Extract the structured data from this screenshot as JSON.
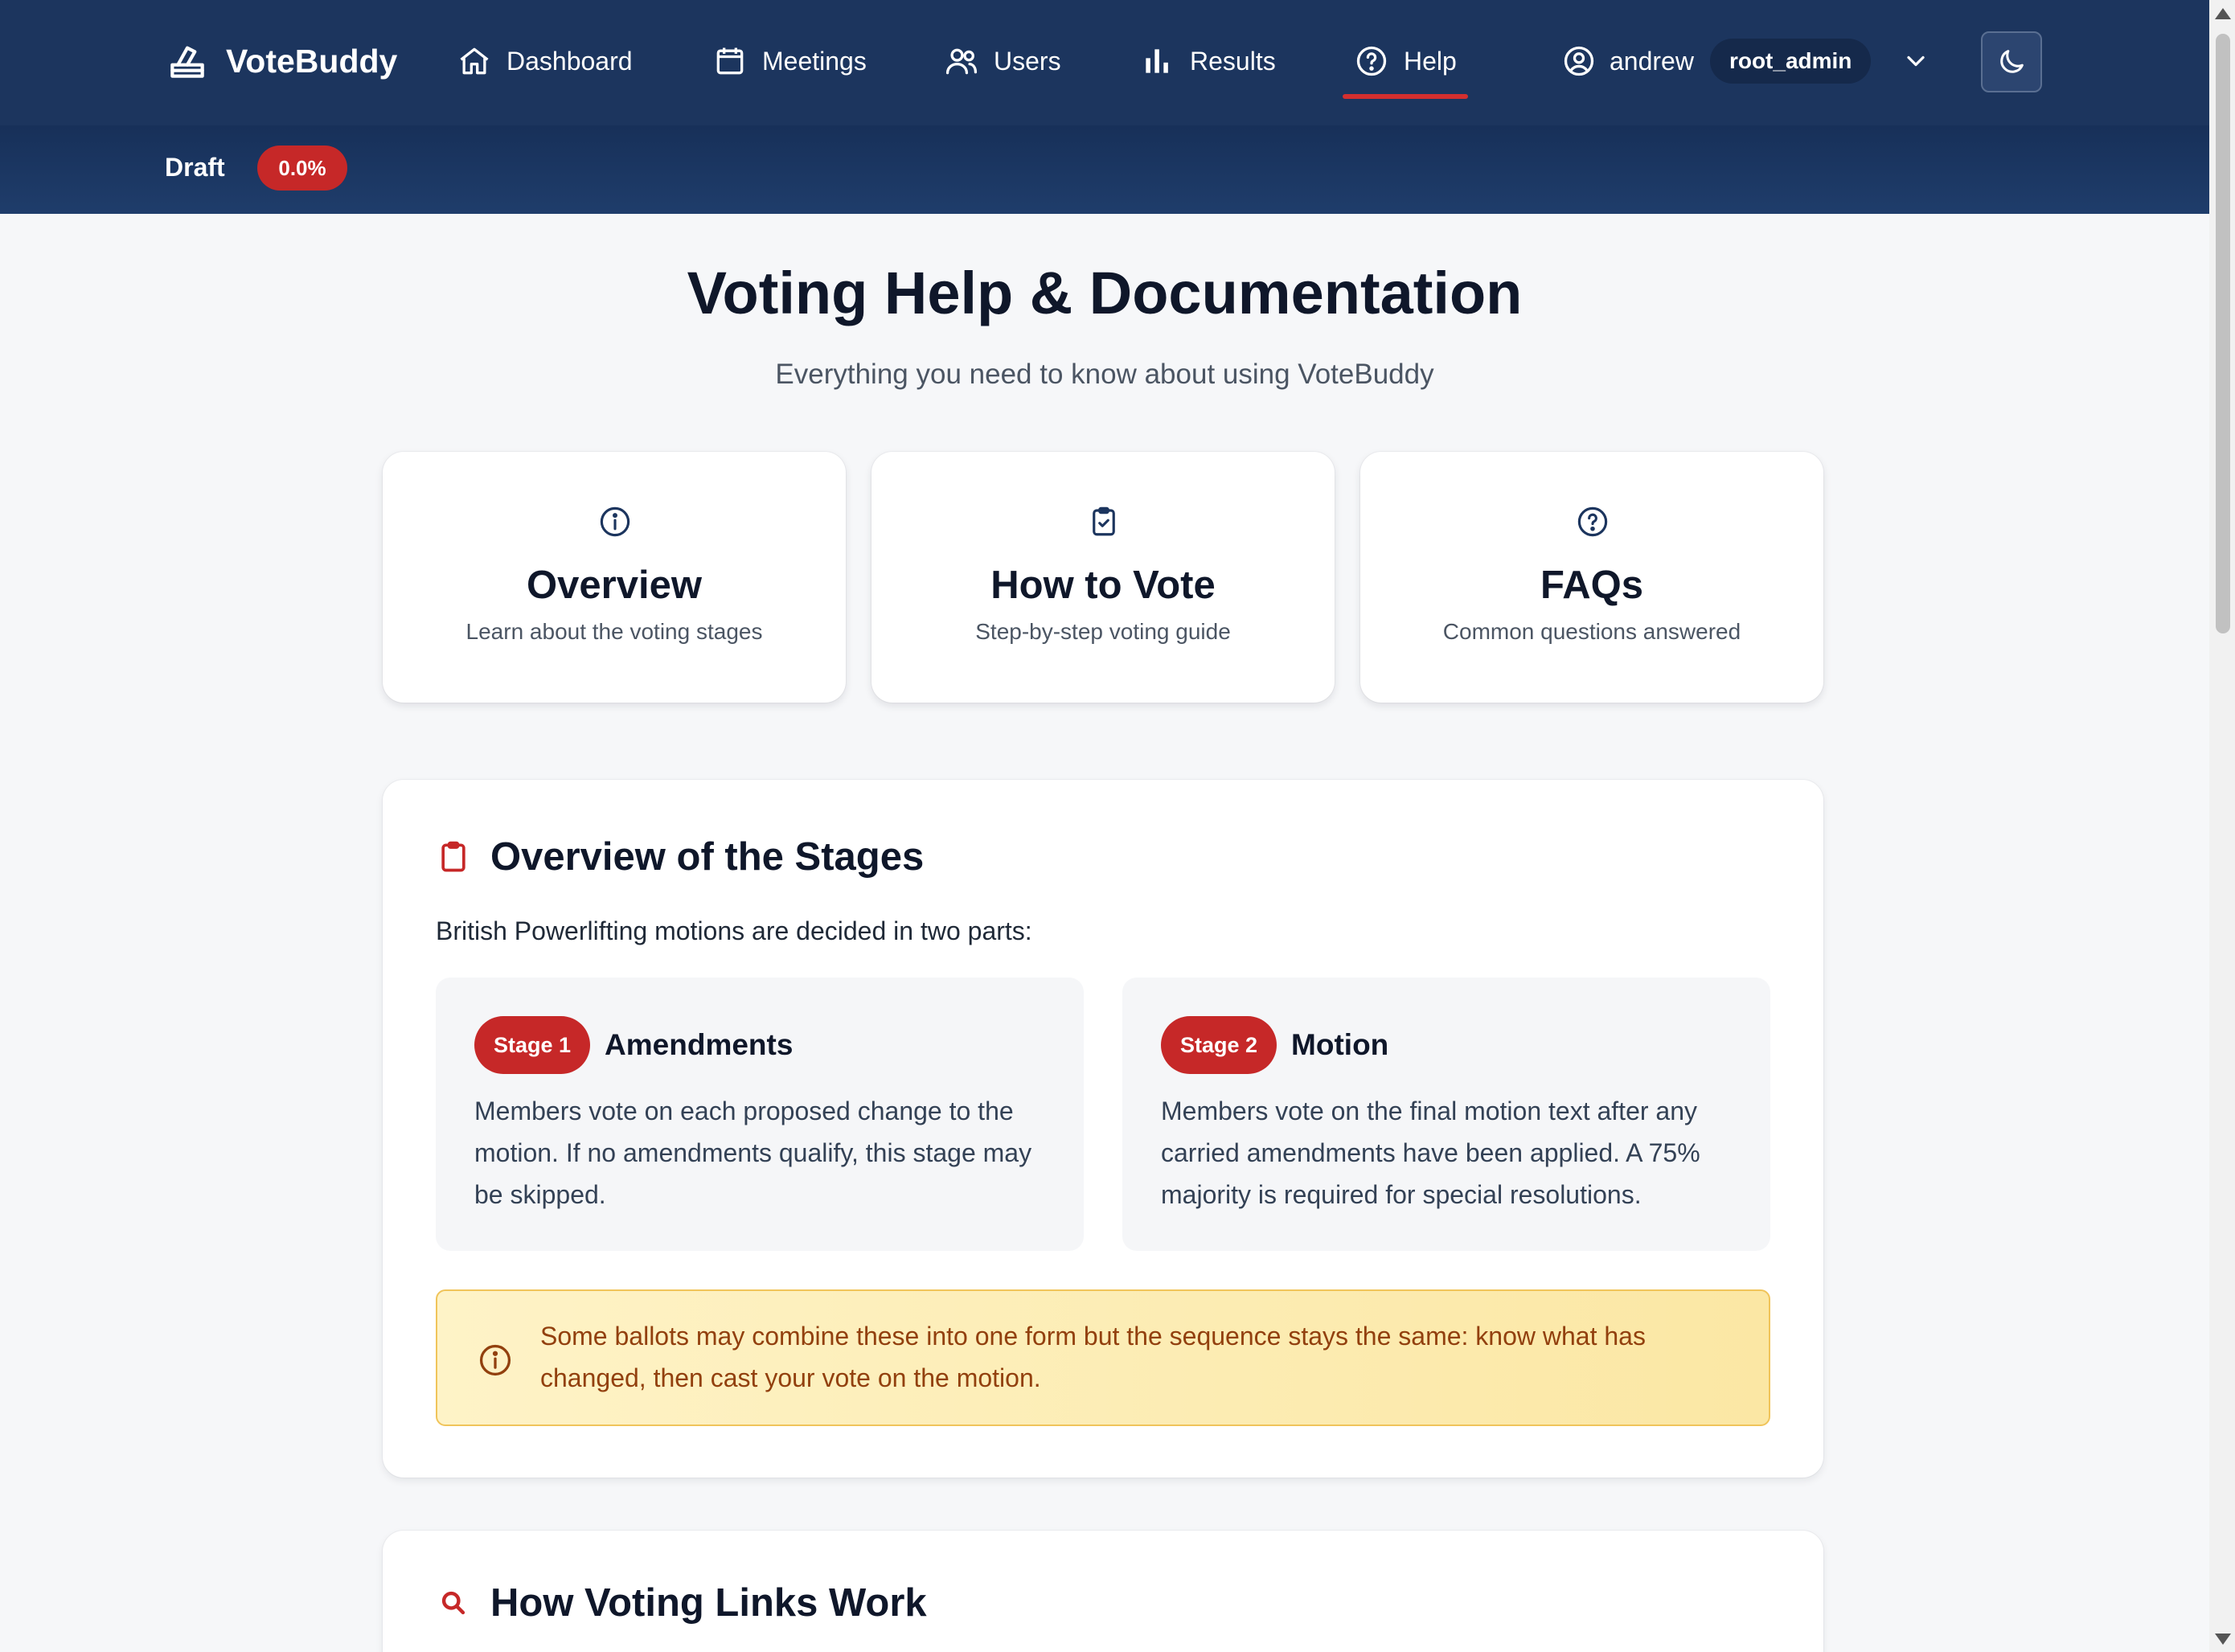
{
  "brand": {
    "name": "VoteBuddy",
    "icon": "ballot-box-icon"
  },
  "nav": {
    "items": [
      {
        "label": "Dashboard",
        "icon": "home-icon"
      },
      {
        "label": "Meetings",
        "icon": "calendar-icon"
      },
      {
        "label": "Users",
        "icon": "users-icon"
      },
      {
        "label": "Results",
        "icon": "bar-chart-icon"
      },
      {
        "label": "Help",
        "icon": "help-circle-icon",
        "active": true
      }
    ],
    "user": {
      "name": "andrew",
      "role": "root_admin"
    },
    "theme_toggle_icon": "moon-icon"
  },
  "status_bar": {
    "label": "Draft",
    "badge": "0.0%"
  },
  "page": {
    "title": "Voting Help & Documentation",
    "subtitle": "Everything you need to know about using VoteBuddy"
  },
  "quick_links": [
    {
      "title": "Overview",
      "subtitle": "Learn about the voting stages",
      "icon": "info-icon"
    },
    {
      "title": "How to Vote",
      "subtitle": "Step-by-step voting guide",
      "icon": "clipboard-check-icon"
    },
    {
      "title": "FAQs",
      "subtitle": "Common questions answered",
      "icon": "question-circle-icon"
    }
  ],
  "stages_section": {
    "title": "Overview of the Stages",
    "intro": "British Powerlifting motions are decided in two parts:",
    "stages": [
      {
        "pill": "Stage 1",
        "name": "Amendments",
        "text": "Members vote on each proposed change to the motion. If no amendments qualify, this stage may be skipped."
      },
      {
        "pill": "Stage 2",
        "name": "Motion",
        "text": "Members vote on the final motion text after any carried amendments have been applied. A 75% majority is required for special resolutions."
      }
    ],
    "note": "Some ballots may combine these into one form but the sequence stays the same: know what has changed, then cast your vote on the motion."
  },
  "links_section": {
    "title": "How Voting Links Work"
  },
  "colors": {
    "nav_bg": "#1c355e",
    "accent": "#c62828",
    "note_bg": "#fef3c7",
    "note_text": "#92400e"
  }
}
